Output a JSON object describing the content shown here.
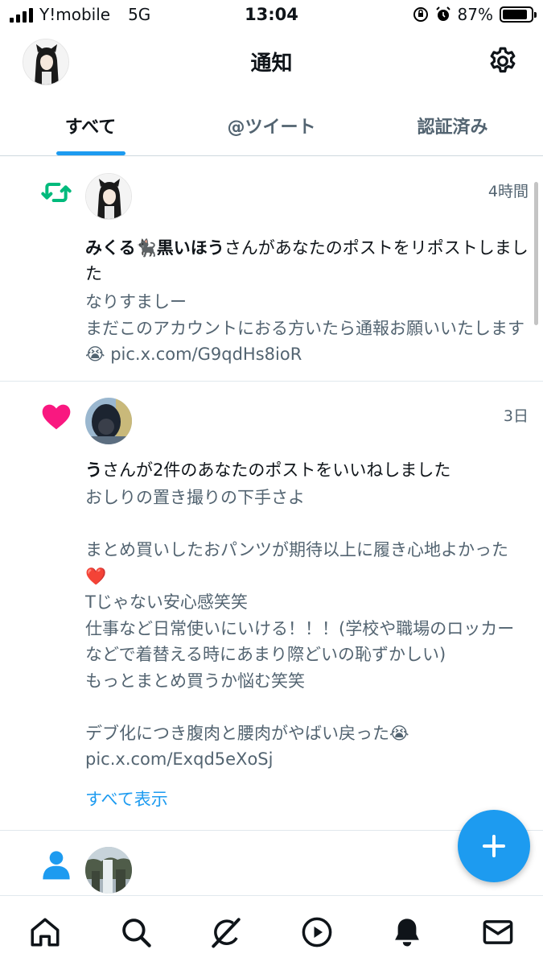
{
  "status_bar": {
    "carrier": "Y!mobile",
    "network": "5G",
    "time": "13:04",
    "battery": "87%",
    "battery_level": 0.87
  },
  "header": {
    "title": "通知"
  },
  "tabs": [
    {
      "label": "すべて",
      "active": true
    },
    {
      "label": "@ツイート",
      "active": false
    },
    {
      "label": "認証済み",
      "active": false
    }
  ],
  "notifications": [
    {
      "type": "retweet",
      "icon": "retweet-icon",
      "time": "4時間",
      "user": "みくる🐈‍⬛黒いほう",
      "action": "さんがあなたのポストをリポストしました",
      "body": "なりすましー\nまだこのアカウントにおる方いたら通報お願いいたします😭 pic.x.com/G9qdHs8ioR"
    },
    {
      "type": "like",
      "icon": "heart-icon",
      "time": "3日",
      "user": "う",
      "action": "さんが2件のあなたのポストをいいねしました",
      "body": "おしりの置き撮りの下手さよ\n\nまとめ買いしたおパンツが期待以上に履き心地よかった❤️\nTじゃない安心感笑笑\n仕事など日常使いにいける！！！(学校や職場のロッカーなどで着替える時にあまり際どいの恥ずかしい)\nもっとまとめ買うか悩む笑笑\n\nデブ化につき腹肉と腰肉がやばい戻った😭\npic.x.com/Exqd5eXoSj",
      "show_all": "すべて表示"
    },
    {
      "type": "follow",
      "icon": "person-icon"
    }
  ],
  "colors": {
    "accent": "#1d9bf0",
    "retweet": "#00ba7c",
    "like": "#f91880",
    "secondary_text": "#536471"
  },
  "bottom_nav": [
    "home-icon",
    "search-icon",
    "grok-icon",
    "play-icon",
    "bell-icon",
    "mail-icon"
  ]
}
